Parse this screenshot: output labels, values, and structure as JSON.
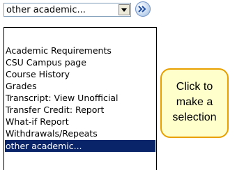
{
  "dropdown": {
    "selected_value": "other academic...",
    "icons": {
      "arrow": "chevron-down-icon",
      "go": "double-chevron-right-icon"
    }
  },
  "listbox": {
    "items": [
      "Academic Requirements",
      "CSU Campus page",
      "Course History",
      "Grades",
      "Transcript: View Unofficial",
      "Transfer Credit: Report",
      "What-if Report",
      "Withdrawals/Repeats",
      "other academic..."
    ],
    "selected_index": 8
  },
  "callout": {
    "line1": "Click to",
    "line2": "make a",
    "line3": "selection"
  },
  "colors": {
    "selection": "#0a246a",
    "callout_fill": "#ffffcc",
    "callout_border": "#e8a000"
  }
}
